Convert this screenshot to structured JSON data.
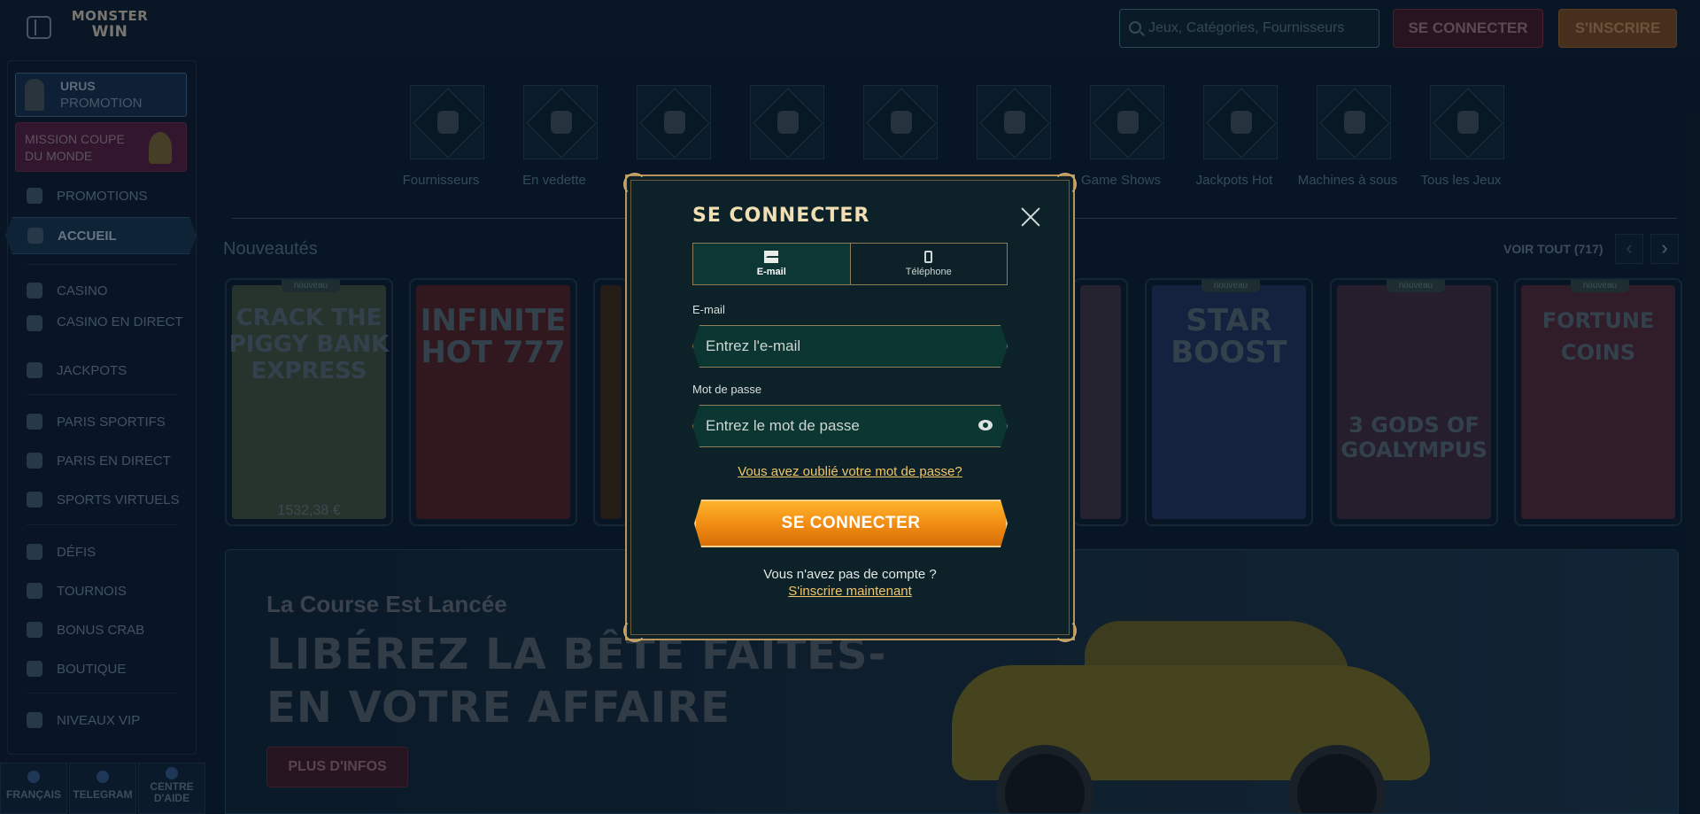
{
  "header": {
    "logo_line1": "MONSTER",
    "logo_line2": "WIN",
    "search_placeholder": "Jeux, Catégories, Fournisseurs",
    "login_label": "SE CONNECTER",
    "signup_label": "S'INSCRIRE"
  },
  "sidebar": {
    "promo_urus": {
      "title": "URUS",
      "subtitle": "PROMOTION"
    },
    "promo_world": {
      "label": "MISSION COUPE DU MONDE"
    },
    "items": [
      {
        "label": "PROMOTIONS"
      },
      {
        "label": "ACCUEIL"
      },
      {
        "label": "CASINO"
      },
      {
        "label": "CASINO EN DIRECT"
      },
      {
        "label": "JACKPOTS"
      },
      {
        "label": "PARIS SPORTIFS"
      },
      {
        "label": "PARIS EN DIRECT"
      },
      {
        "label": "SPORTS VIRTUELS"
      },
      {
        "label": "DÉFIS"
      },
      {
        "label": "TOURNOIS"
      },
      {
        "label": "BONUS CRAB"
      },
      {
        "label": "BOUTIQUE"
      },
      {
        "label": "NIVEAUX VIP"
      }
    ],
    "footer": [
      {
        "label": "FRANÇAIS"
      },
      {
        "label": "TELEGRAM"
      },
      {
        "label": "CENTRE D'AIDE"
      }
    ]
  },
  "categories": [
    {
      "label": "Fournisseurs"
    },
    {
      "label": "En vedette"
    },
    {
      "label": ""
    },
    {
      "label": ""
    },
    {
      "label": ""
    },
    {
      "label": ""
    },
    {
      "label": "Game Shows"
    },
    {
      "label": "Jackpots Hot"
    },
    {
      "label": "Machines à sous"
    },
    {
      "label": "Tous les Jeux"
    }
  ],
  "new_games": {
    "title": "Nouveautés",
    "see_all": "VOIR TOUT (717)",
    "games": [
      {
        "name": "CRACK THE PIGGY BANK EXPRESS",
        "badge": "nouveau",
        "price": "1532,38 €",
        "color": "#3b4a3a"
      },
      {
        "name": "INFINITE HOT 777",
        "badge": "",
        "price": "",
        "color": "#4a1f22"
      },
      {
        "name": "",
        "badge": "",
        "price": "",
        "color": "#3a2618"
      },
      {
        "name": "STAR BOOST",
        "badge": "nouveau",
        "price": "",
        "color": "#1f2e55"
      },
      {
        "name": "3 GODS OF GOALYMPUS",
        "badge": "nouveau",
        "price": "",
        "color": "#3a2838"
      },
      {
        "name": "FORTUNE COINS",
        "badge": "nouveau",
        "price": "",
        "color": "#4a2634"
      }
    ]
  },
  "banner": {
    "subtitle": "La Course Est Lancée",
    "headline_line1": "LIBÉREZ LA BÊTE FAITES-",
    "headline_line2": "EN VOTRE AFFAIRE",
    "button": "PLUS D'INFOS"
  },
  "login_modal": {
    "title": "SE CONNECTER",
    "tabs": [
      {
        "label": "E-mail",
        "icon": "envelope-icon",
        "active": true
      },
      {
        "label": "Téléphone",
        "icon": "phone-icon",
        "active": false
      }
    ],
    "email_label": "E-mail",
    "email_placeholder": "Entrez l'e-mail",
    "password_label": "Mot de passe",
    "password_placeholder": "Entrez le mot de passe",
    "forgot": "Vous avez oublié votre mot de passe?",
    "submit": "SE CONNECTER",
    "no_account": "Vous n'avez pas de compte ?",
    "signup_link": "S'inscrire maintenant",
    "accent_color": "#f08a12",
    "border_color": "#b8935a"
  }
}
